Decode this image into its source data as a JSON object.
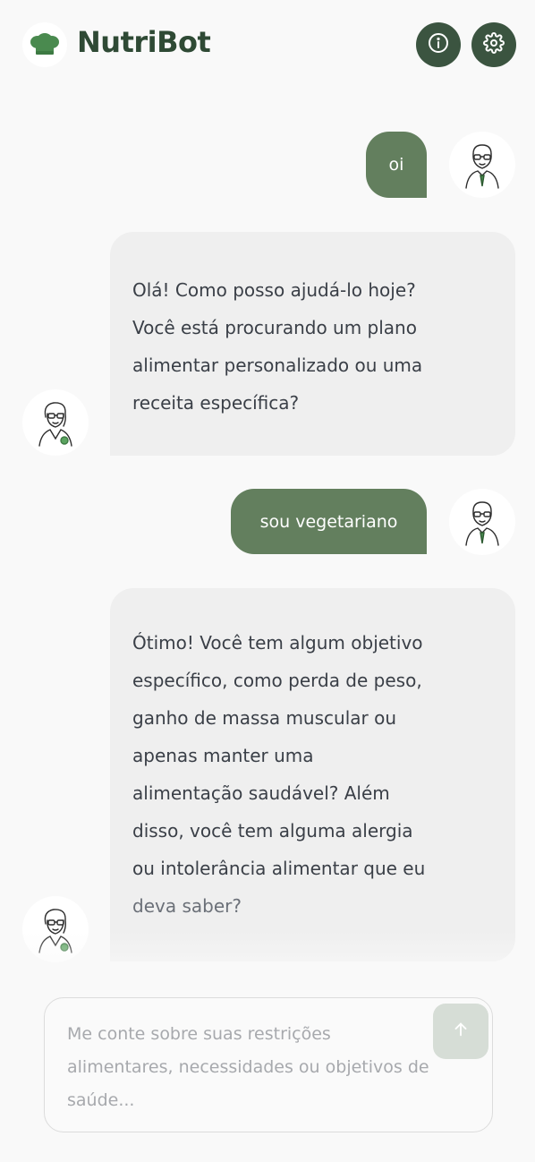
{
  "app": {
    "title": "NutriBot",
    "logo_icon": "chef-hat-icon",
    "brand_color": "#3b5440"
  },
  "header": {
    "info_icon": "info-icon",
    "settings_icon": "gear-icon"
  },
  "messages": [
    {
      "role": "user",
      "text": "oi"
    },
    {
      "role": "bot",
      "lines": [
        "Olá! Como posso ajudá-lo hoje?",
        "Você está procurando um plano",
        "alimentar personalizado ou uma",
        "receita específica?"
      ]
    },
    {
      "role": "user",
      "text": "sou vegetariano"
    },
    {
      "role": "bot",
      "lines": [
        "Ótimo! Você tem algum objetivo",
        "específico, como perda de peso,",
        "ganho de massa muscular ou",
        "apenas manter uma",
        "alimentação saudável? Além",
        "disso, você tem alguma alergia",
        "ou intolerância alimentar que eu",
        "deva saber?"
      ]
    }
  ],
  "composer": {
    "placeholder": "Me conte sobre suas restrições alimentares, necessidades ou objetivos de saúde...",
    "send_icon": "arrow-up-icon"
  }
}
